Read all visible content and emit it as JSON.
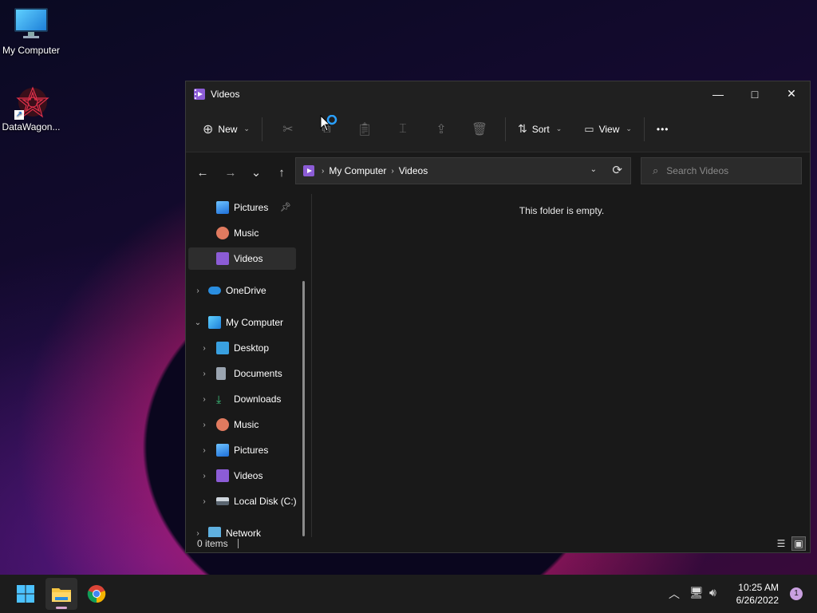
{
  "desktop": {
    "icons": [
      {
        "label": "My Computer",
        "icon": "monitor-icon"
      },
      {
        "label": "DataWagon...",
        "icon": "datawagon-star-icon"
      }
    ]
  },
  "window": {
    "title": "Videos",
    "controls": {
      "minimize": "—",
      "maximize": "□",
      "close": "✕"
    }
  },
  "toolbar": {
    "new_label": "New",
    "sort_label": "Sort",
    "view_label": "View",
    "more_label": "•••"
  },
  "nav": {
    "back": "←",
    "forward": "→",
    "recent": "⌄",
    "up": "↑"
  },
  "address": {
    "crumbs": [
      "My Computer",
      "Videos"
    ],
    "refresh": "⟳"
  },
  "search": {
    "placeholder": "Search Videos"
  },
  "sidebar": {
    "quick_items": [
      {
        "label": "Pictures",
        "icon": "pictures-icon",
        "pinned": true
      },
      {
        "label": "Music",
        "icon": "music-icon"
      },
      {
        "label": "Videos",
        "icon": "videos-icon",
        "selected": true
      }
    ],
    "onedrive": "OneDrive",
    "my_computer": "My Computer",
    "computer_items": [
      {
        "label": "Desktop",
        "icon": "desktop-folder-icon"
      },
      {
        "label": "Documents",
        "icon": "documents-icon"
      },
      {
        "label": "Downloads",
        "icon": "downloads-icon"
      },
      {
        "label": "Music",
        "icon": "music-icon"
      },
      {
        "label": "Pictures",
        "icon": "pictures-icon"
      },
      {
        "label": "Videos",
        "icon": "videos-icon"
      },
      {
        "label": "Local Disk (C:)",
        "icon": "local-disk-icon"
      }
    ],
    "network": "Network"
  },
  "content": {
    "empty_message": "This folder is empty."
  },
  "status": {
    "items": "0 items"
  },
  "taskbar": {
    "time": "10:25 AM",
    "date": "6/26/2022",
    "notifications": "1"
  },
  "colors": {
    "window_bg": "#191919",
    "toolbar_bg": "#202020",
    "accent_purple": "#8c5cd6",
    "taskbar_bg": "#1c1c1c"
  }
}
